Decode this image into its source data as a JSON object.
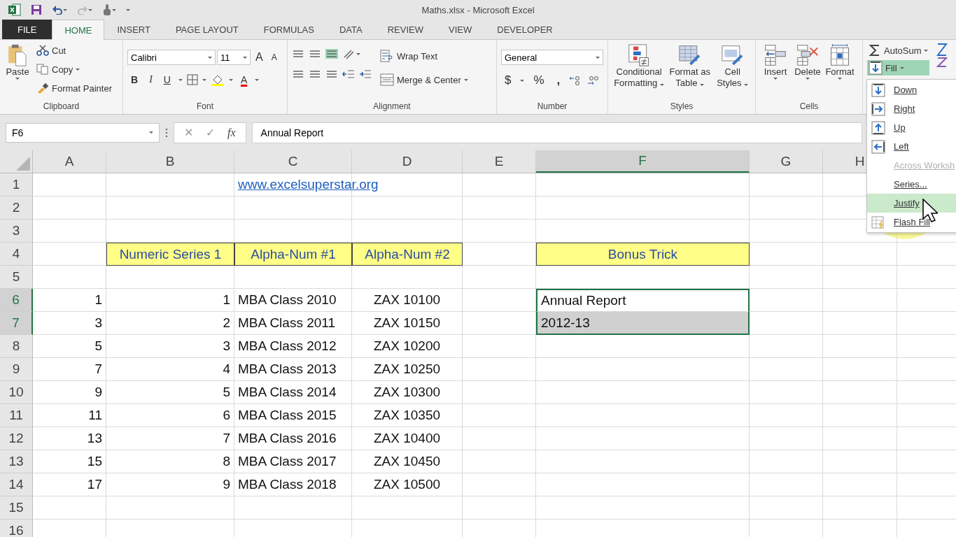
{
  "window": {
    "title": "Maths.xlsx - Microsoft Excel"
  },
  "tabs": [
    {
      "label": "FILE",
      "kind": "file",
      "selected": false
    },
    {
      "label": "HOME",
      "kind": "tab",
      "selected": true
    },
    {
      "label": "INSERT",
      "kind": "tab",
      "selected": false
    },
    {
      "label": "PAGE LAYOUT",
      "kind": "tab",
      "selected": false
    },
    {
      "label": "FORMULAS",
      "kind": "tab",
      "selected": false
    },
    {
      "label": "DATA",
      "kind": "tab",
      "selected": false
    },
    {
      "label": "REVIEW",
      "kind": "tab",
      "selected": false
    },
    {
      "label": "VIEW",
      "kind": "tab",
      "selected": false
    },
    {
      "label": "DEVELOPER",
      "kind": "tab",
      "selected": false
    }
  ],
  "clipboard": {
    "label": "Clipboard",
    "paste": "Paste",
    "cut": "Cut",
    "copy": "Copy",
    "format_painter": "Format Painter"
  },
  "font": {
    "label": "Font",
    "name": "Calibri",
    "size": "11",
    "grow": "A",
    "shrink": "A",
    "styles": [
      "B",
      "I",
      "U"
    ],
    "font_color": "A"
  },
  "alignment": {
    "label": "Alignment",
    "wrap_text": "Wrap Text",
    "merge": "Merge & Center"
  },
  "number": {
    "label": "Number",
    "format": "General",
    "currency": "$",
    "percent": "%",
    "comma": ","
  },
  "styles": {
    "label": "Styles",
    "buttons": [
      {
        "label": "Conditional Formatting",
        "kind": "conditional"
      },
      {
        "label": "Format as Table",
        "kind": "table"
      },
      {
        "label": "Cell Styles",
        "kind": "cellstyles"
      }
    ]
  },
  "cells": {
    "label": "Cells",
    "buttons": [
      {
        "label": "Insert",
        "kind": "insert"
      },
      {
        "label": "Delete",
        "kind": "delete"
      },
      {
        "label": "Format",
        "kind": "format"
      }
    ]
  },
  "editing": {
    "autosum": "AutoSum",
    "fill": "Fill",
    "fill_expanded": true
  },
  "fill_menu": [
    {
      "label": "Down",
      "kind": "down",
      "disabled": false,
      "selected": false
    },
    {
      "label": "Right",
      "kind": "right",
      "disabled": false,
      "selected": false
    },
    {
      "label": "Up",
      "kind": "up",
      "disabled": false,
      "selected": false
    },
    {
      "label": "Left",
      "kind": "left",
      "disabled": false,
      "selected": false
    },
    {
      "label": "Across Worksh",
      "kind": "plain",
      "disabled": true,
      "selected": false
    },
    {
      "label": "Series...",
      "kind": "plain",
      "disabled": false,
      "selected": false
    },
    {
      "label": "Justify",
      "kind": "plain",
      "disabled": false,
      "selected": true
    },
    {
      "label": "Flash Fill",
      "kind": "flash",
      "disabled": false,
      "selected": false
    }
  ],
  "formula_bar": {
    "name_box": "F6",
    "cancel": "✕",
    "enter": "✓",
    "function_label": "fx",
    "formula": "Annual Report"
  },
  "columns": [
    {
      "label": "A",
      "selected": false
    },
    {
      "label": "B",
      "selected": false
    },
    {
      "label": "C",
      "selected": false
    },
    {
      "label": "D",
      "selected": false
    },
    {
      "label": "E",
      "selected": false
    },
    {
      "label": "F",
      "selected": true
    },
    {
      "label": "G",
      "selected": false
    },
    {
      "label": "H",
      "selected": false
    }
  ],
  "rows": [
    {
      "label": "1",
      "selected": false,
      "cells": [
        null,
        null,
        {
          "text": "www.excelsuperstar.org",
          "kind": "link",
          "selected": false
        },
        null,
        null,
        null,
        null,
        null
      ]
    },
    {
      "label": "2",
      "selected": false,
      "cells": [
        null,
        null,
        null,
        null,
        null,
        null,
        null,
        null
      ]
    },
    {
      "label": "3",
      "selected": false,
      "cells": [
        null,
        null,
        null,
        null,
        null,
        null,
        null,
        null
      ]
    },
    {
      "label": "4",
      "selected": false,
      "cells": [
        null,
        {
          "text": "Numeric Series 1",
          "kind": "header",
          "selected": false
        },
        {
          "text": "Alpha-Num #1",
          "kind": "header",
          "selected": false
        },
        {
          "text": "Alpha-Num #2",
          "kind": "header",
          "selected": false
        },
        null,
        {
          "text": "Bonus Trick",
          "kind": "header",
          "selected": false
        },
        null,
        null
      ]
    },
    {
      "label": "5",
      "selected": false,
      "cells": [
        null,
        null,
        null,
        null,
        null,
        null,
        null,
        null
      ]
    },
    {
      "label": "6",
      "selected": true,
      "cells": [
        {
          "text": "1",
          "kind": "number",
          "selected": false
        },
        {
          "text": "1",
          "kind": "number",
          "selected": false
        },
        {
          "text": "MBA Class 2010",
          "kind": "text",
          "selected": false
        },
        {
          "text": "ZAX 10100",
          "kind": "center",
          "selected": false
        },
        null,
        {
          "text": "Annual Report",
          "kind": "active",
          "selected": true
        },
        null,
        null
      ]
    },
    {
      "label": "7",
      "selected": true,
      "cells": [
        {
          "text": "3",
          "kind": "number",
          "selected": false
        },
        {
          "text": "2",
          "kind": "number",
          "selected": false
        },
        {
          "text": "MBA Class 2011",
          "kind": "text",
          "selected": false
        },
        {
          "text": "ZAX 10150",
          "kind": "center",
          "selected": false
        },
        null,
        {
          "text": "2012-13",
          "kind": "range",
          "selected": true
        },
        null,
        null
      ]
    },
    {
      "label": "8",
      "selected": false,
      "cells": [
        {
          "text": "5",
          "kind": "number",
          "selected": false
        },
        {
          "text": "3",
          "kind": "number",
          "selected": false
        },
        {
          "text": "MBA Class 2012",
          "kind": "text",
          "selected": false
        },
        {
          "text": "ZAX 10200",
          "kind": "center",
          "selected": false
        },
        null,
        null,
        null,
        null
      ]
    },
    {
      "label": "9",
      "selected": false,
      "cells": [
        {
          "text": "7",
          "kind": "number",
          "selected": false
        },
        {
          "text": "4",
          "kind": "number",
          "selected": false
        },
        {
          "text": "MBA Class 2013",
          "kind": "text",
          "selected": false
        },
        {
          "text": "ZAX 10250",
          "kind": "center",
          "selected": false
        },
        null,
        null,
        null,
        null
      ]
    },
    {
      "label": "10",
      "selected": false,
      "cells": [
        {
          "text": "9",
          "kind": "number",
          "selected": false
        },
        {
          "text": "5",
          "kind": "number",
          "selected": false
        },
        {
          "text": "MBA Class 2014",
          "kind": "text",
          "selected": false
        },
        {
          "text": "ZAX 10300",
          "kind": "center",
          "selected": false
        },
        null,
        null,
        null,
        null
      ]
    },
    {
      "label": "11",
      "selected": false,
      "cells": [
        {
          "text": "11",
          "kind": "number",
          "selected": false
        },
        {
          "text": "6",
          "kind": "number",
          "selected": false
        },
        {
          "text": "MBA Class 2015",
          "kind": "text",
          "selected": false
        },
        {
          "text": "ZAX 10350",
          "kind": "center",
          "selected": false
        },
        null,
        null,
        null,
        null
      ]
    },
    {
      "label": "12",
      "selected": false,
      "cells": [
        {
          "text": "13",
          "kind": "number",
          "selected": false
        },
        {
          "text": "7",
          "kind": "number",
          "selected": false
        },
        {
          "text": "MBA Class 2016",
          "kind": "text",
          "selected": false
        },
        {
          "text": "ZAX 10400",
          "kind": "center",
          "selected": false
        },
        null,
        null,
        null,
        null
      ]
    },
    {
      "label": "13",
      "selected": false,
      "cells": [
        {
          "text": "15",
          "kind": "number",
          "selected": false
        },
        {
          "text": "8",
          "kind": "number",
          "selected": false
        },
        {
          "text": "MBA Class 2017",
          "kind": "text",
          "selected": false
        },
        {
          "text": "ZAX 10450",
          "kind": "center",
          "selected": false
        },
        null,
        null,
        null,
        null
      ]
    },
    {
      "label": "14",
      "selected": false,
      "cells": [
        {
          "text": "17",
          "kind": "number",
          "selected": false
        },
        {
          "text": "9",
          "kind": "number",
          "selected": false
        },
        {
          "text": "MBA Class 2018",
          "kind": "text",
          "selected": false
        },
        {
          "text": "ZAX 10500",
          "kind": "center",
          "selected": false
        },
        null,
        null,
        null,
        null
      ]
    },
    {
      "label": "15",
      "selected": false,
      "cells": [
        null,
        null,
        null,
        null,
        null,
        null,
        null,
        null
      ]
    },
    {
      "label": "16",
      "selected": false,
      "cells": [
        null,
        null,
        null,
        null,
        null,
        null,
        null,
        null
      ]
    }
  ]
}
